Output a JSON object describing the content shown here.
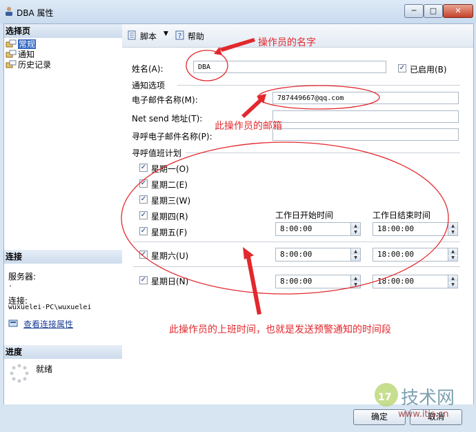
{
  "window": {
    "title": "DBA 属性",
    "buttons": [
      "─",
      "□",
      "✕"
    ]
  },
  "left": {
    "select_page_header": "选择页",
    "pages": [
      "常规",
      "通知",
      "历史记录"
    ],
    "connection_header": "连接",
    "server_label": "服务器:",
    "server_value": ".",
    "connection_label": "连接:",
    "connection_value": "wuxuelei-PC\\wuxuelei",
    "view_props_link": "查看连接属性",
    "progress_header": "进度",
    "progress_status": "就绪"
  },
  "toolbar": {
    "script_label": "脚本",
    "help_label": "帮助"
  },
  "form": {
    "name_label": "姓名(A):",
    "name_value": "DBA",
    "enabled_label": "已启用(B)",
    "notify_group": "通知选项",
    "email_label": "电子邮件名称(M):",
    "email_value": "787449667@qq.com",
    "netsend_label": "Net send 地址(T):",
    "netsend_value": "",
    "pager_label": "寻呼电子邮件名称(P):",
    "pager_value": "",
    "schedule_group": "寻呼值班计划",
    "days": [
      "星期一(O)",
      "星期二(E)",
      "星期三(W)",
      "星期四(R)",
      "星期五(F)",
      "星期六(U)",
      "星期日(N)"
    ],
    "weekday_start_header": "工作日开始时间",
    "weekday_end_header": "工作日结束时间",
    "weekday_start": "8:00:00",
    "weekday_end": "18:00:00",
    "sat_start": "8:00:00",
    "sat_end": "18:00:00",
    "sun_start": "8:00:00",
    "sun_end": "18:00:00"
  },
  "dialog": {
    "ok_label": "确定",
    "cancel_label": "取消"
  },
  "annotations": {
    "operator_name": "操作员的名字",
    "operator_email": "此操作员的邮箱",
    "work_time": "此操作员的上班时间，也就是发送预警通知的时间段"
  },
  "watermark": {
    "brand": "技术网",
    "url": "www.itjs.cn"
  },
  "colors": {
    "annotation": "#e2282d",
    "selection": "#3167c4",
    "link": "#1c3f95"
  }
}
